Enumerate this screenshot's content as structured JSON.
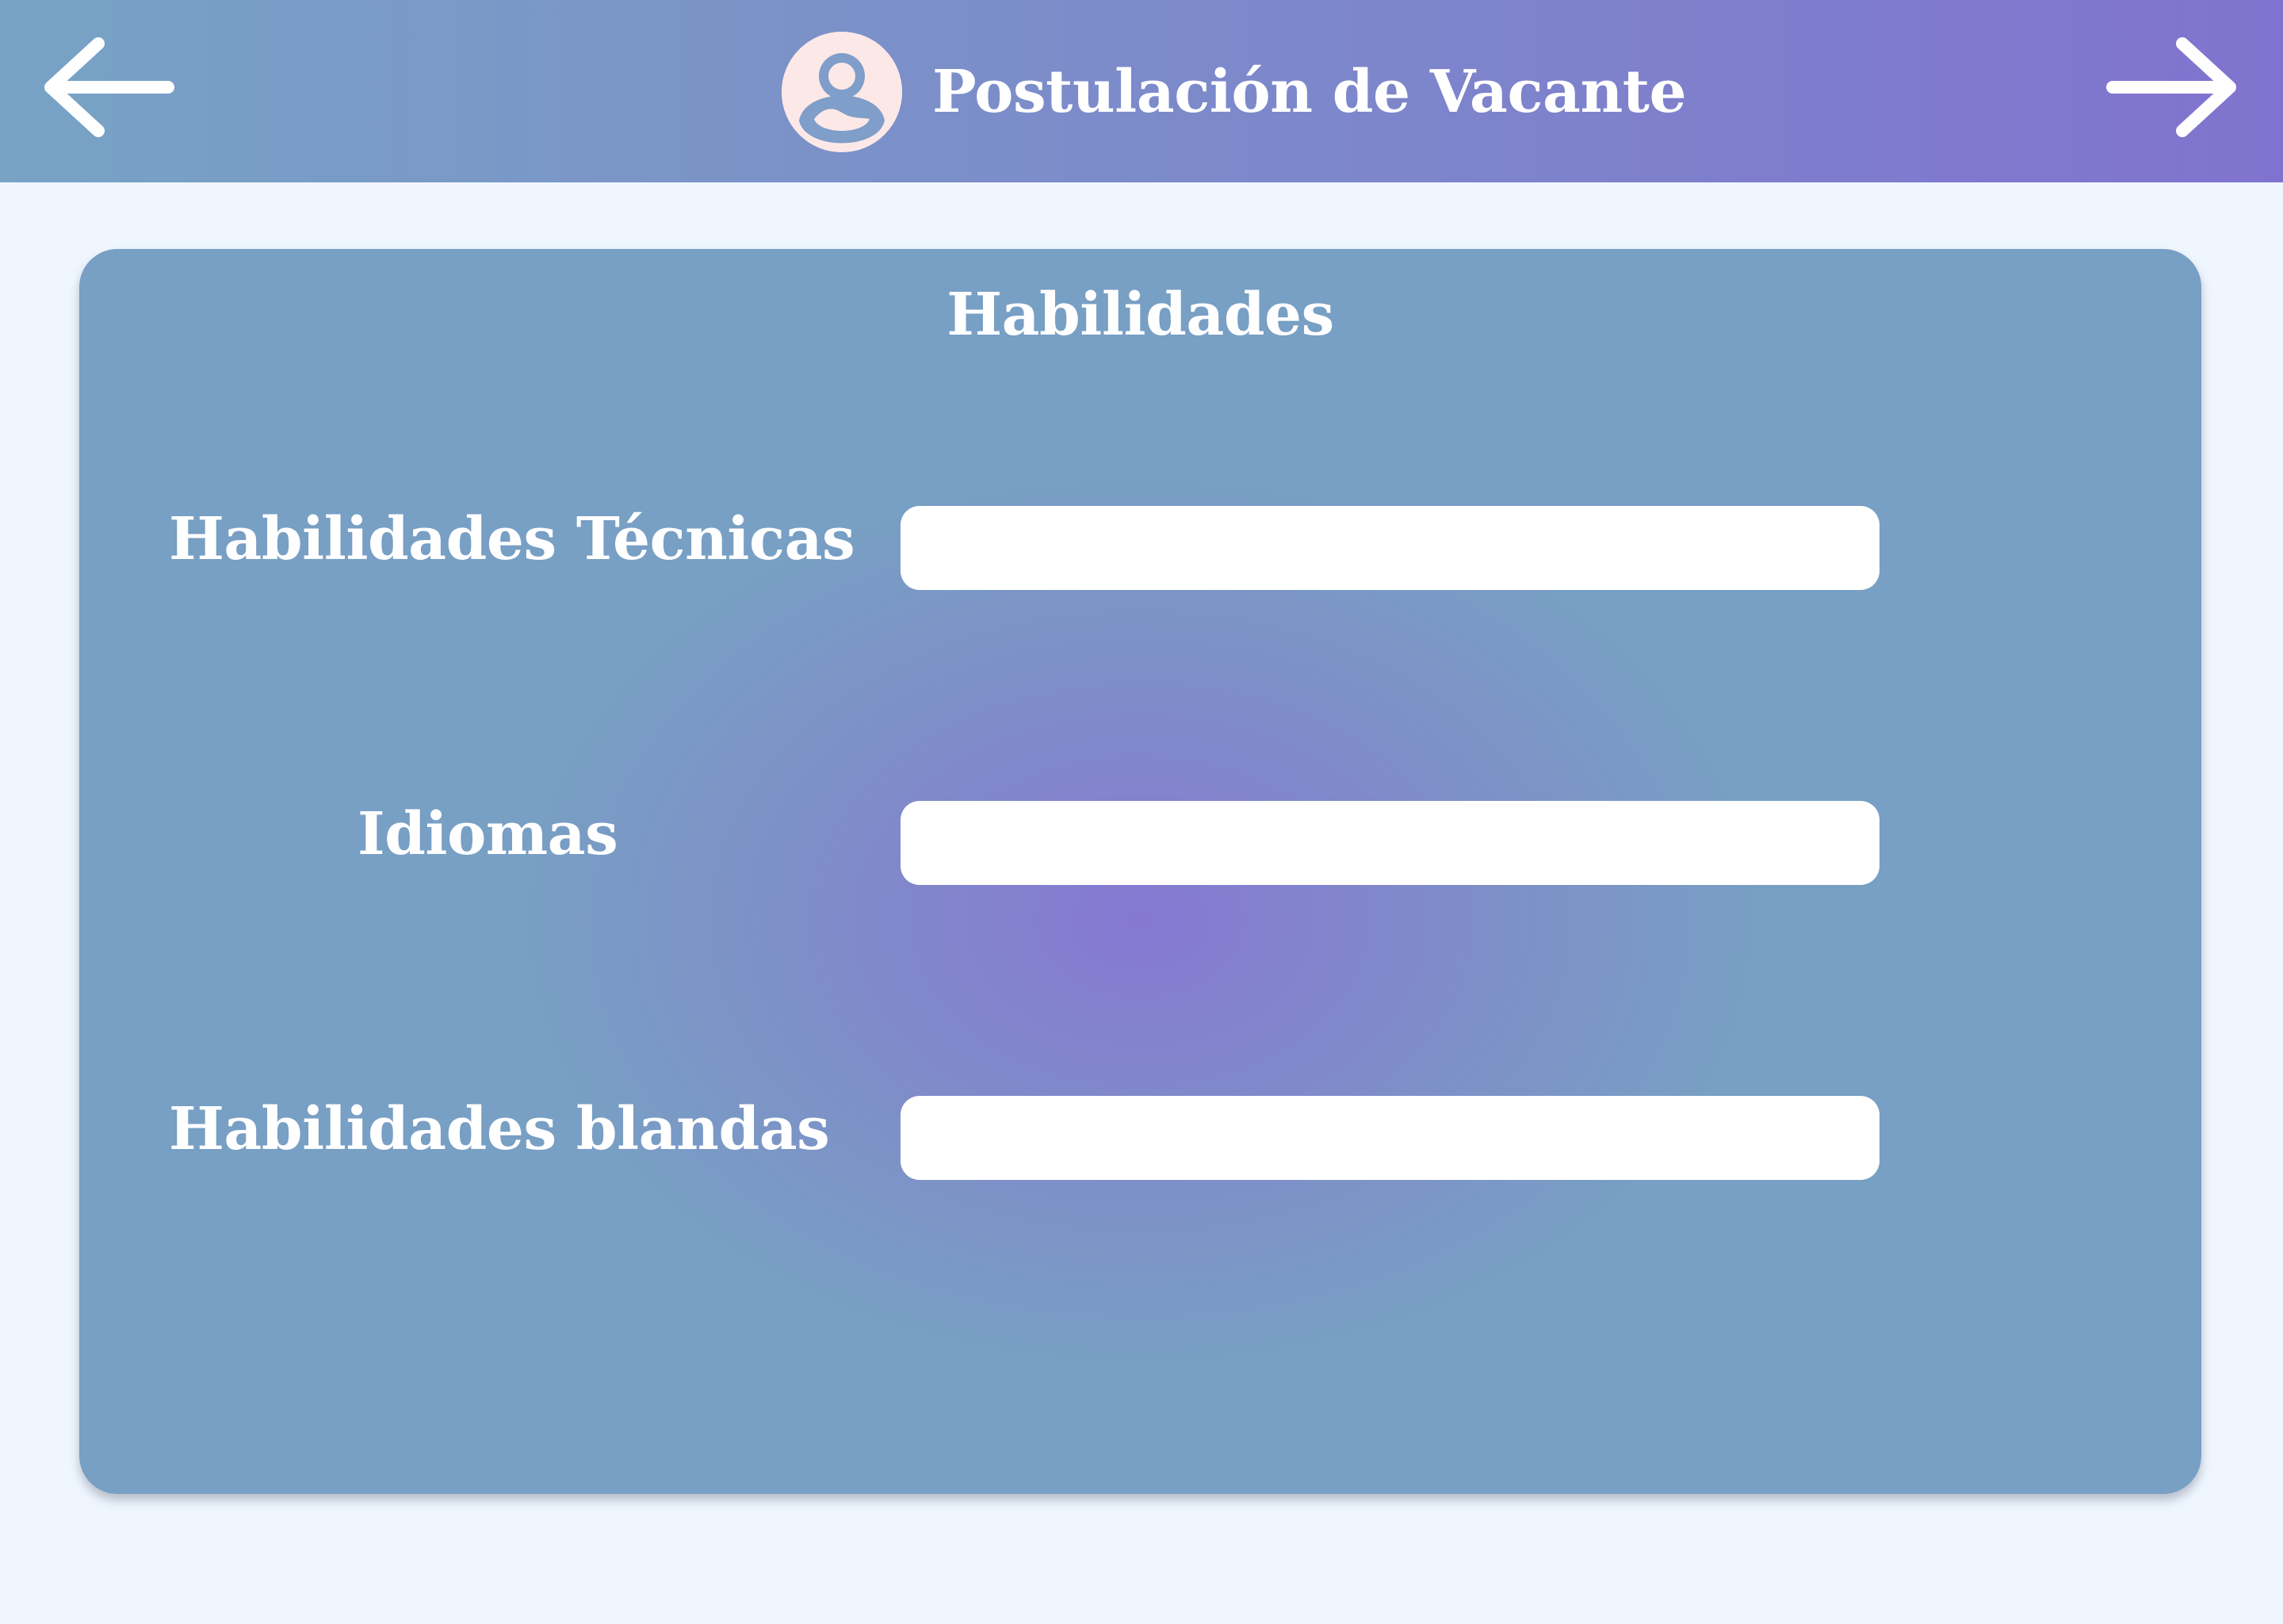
{
  "header": {
    "title": "Postulación de Vacante",
    "back_icon": "arrow-left-icon",
    "forward_icon": "arrow-right-icon",
    "avatar_icon": "user-avatar-icon"
  },
  "card": {
    "title": "Habilidades",
    "fields": [
      {
        "label": "Habilidades Técnicas",
        "value": "",
        "placeholder": ""
      },
      {
        "label": "Idiomas",
        "value": "",
        "placeholder": ""
      },
      {
        "label": "Habilidades blandas",
        "value": "",
        "placeholder": ""
      }
    ]
  },
  "colors": {
    "header_gradient_start": "#78a3c5",
    "header_gradient_end": "#8073cf",
    "card_base": "#789fc4",
    "card_center": "#8678d2",
    "page_background": "#eff6fe",
    "avatar_background": "#fde8e8",
    "text": "#ffffff"
  }
}
